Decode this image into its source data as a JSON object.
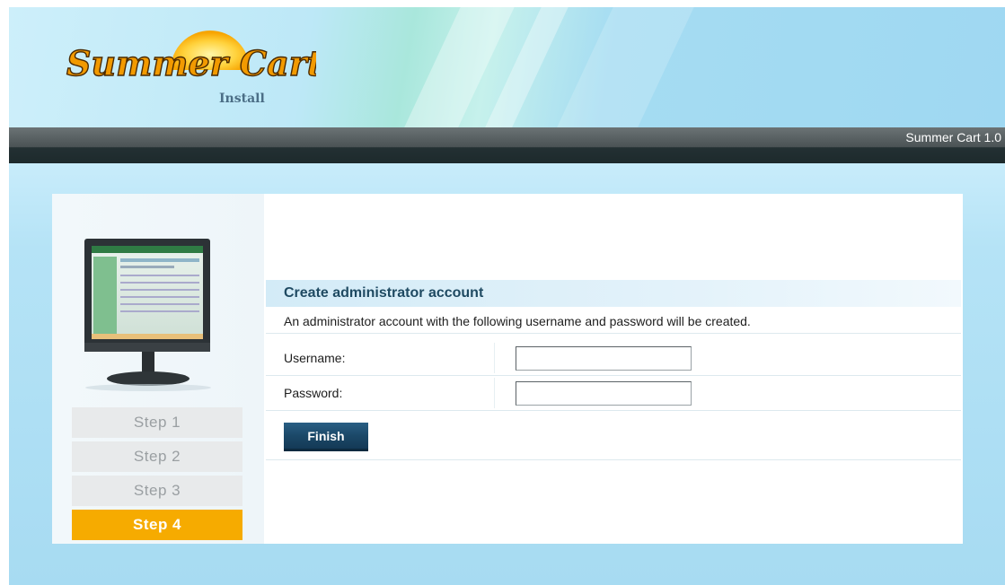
{
  "brand": {
    "logo_text": "Summer Cart",
    "subtitle": "Install"
  },
  "topbar": {
    "version": "Summer Cart 1.0"
  },
  "steps": [
    {
      "label": "Step 1",
      "active": false
    },
    {
      "label": "Step 2",
      "active": false
    },
    {
      "label": "Step 3",
      "active": false
    },
    {
      "label": "Step 4",
      "active": true
    }
  ],
  "form": {
    "title": "Create administrator account",
    "description": "An administrator account with the following username and password will be created.",
    "username_label": "Username:",
    "username_value": "",
    "password_label": "Password:",
    "password_value": "",
    "submit_label": "Finish"
  },
  "colors": {
    "accent": "#f6ab00",
    "button": "#1b4868",
    "background": "#a9dcf3"
  },
  "icons": {
    "monitor": "monitor-icon",
    "logo": "summer-cart-logo"
  }
}
